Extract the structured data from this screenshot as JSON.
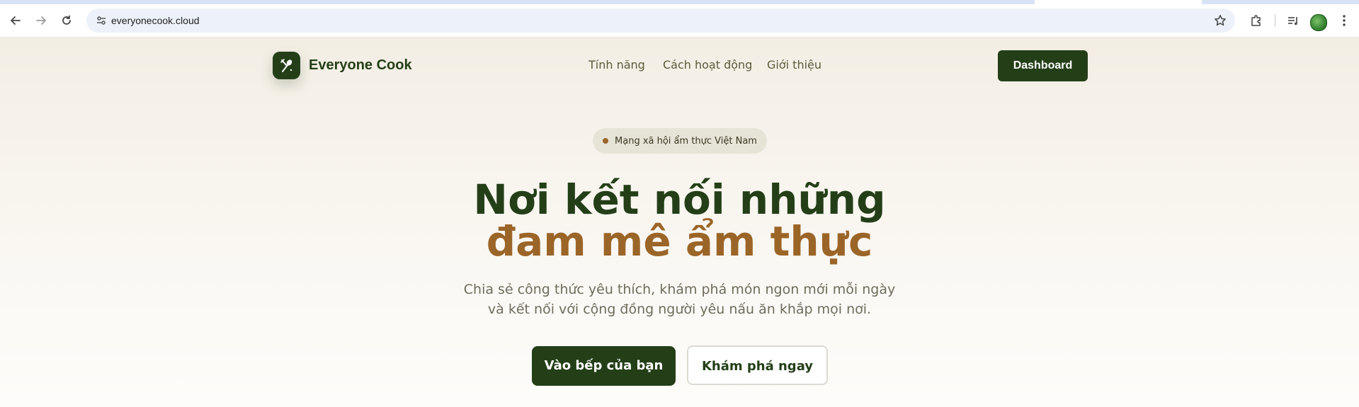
{
  "browser": {
    "url": "everyonecook.cloud",
    "icons": [
      "back-icon",
      "forward-icon",
      "reload-icon",
      "site-info-icon",
      "bookmark-star-icon",
      "extensions-icon",
      "reading-list-icon",
      "profile-avatar",
      "menu-icon"
    ]
  },
  "header": {
    "brand": "Everyone Cook",
    "nav": [
      "Tính năng",
      "Cách hoạt động",
      "Giới thiệu"
    ],
    "dashboard_label": "Dashboard"
  },
  "hero": {
    "badge": "Mạng xã hội ẩm thực Việt Nam",
    "title_line1": "Nơi kết nối những",
    "title_line2": "đam mê ẩm thực",
    "subtitle_line1": "Chia sẻ công thức yêu thích, khám phá món ngon mới mỗi ngày",
    "subtitle_line2": "và kết nối với cộng đồng người yêu nấu ăn khắp mọi nơi.",
    "primary_cta": "Vào bếp của bạn",
    "secondary_cta": "Khám phá ngay"
  },
  "colors": {
    "primary": "#243f18",
    "accent": "#9b6528",
    "badge_bg": "#e6e3d7",
    "text_muted": "#6f6c5d"
  }
}
